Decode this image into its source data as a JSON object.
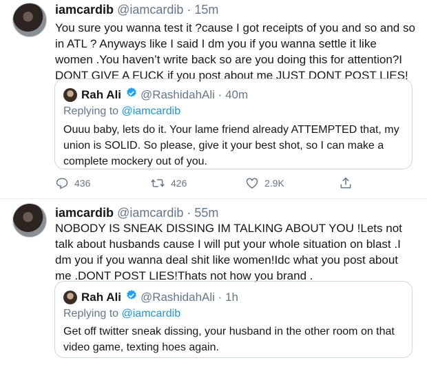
{
  "tweets": [
    {
      "name": "iamcardib",
      "handle": "@iamcardib",
      "separator": "·",
      "time": "15m",
      "text": "You sure you wanna test it ?cause I got receipts of you and so and so in ATL ? Anyways like I said I dm you if you wanna settle it like women .You haven’t write back so are you doing this for attention?I DONT GIVE A FUCK if you post about me JUST DONT POST LIES!",
      "quote": {
        "name": "Rah Ali",
        "handle": "@RashidahAli",
        "separator": "·",
        "time": "40m",
        "replying_prefix": "Replying to",
        "replying_to": "@iamcardib",
        "text": "Ouuu baby, lets do it. Your lame friend already ATTEMPTED that, my union is SOLID. So please, give it your best shot, so I can make a complete mockery out of you."
      },
      "actions": {
        "replies": "436",
        "retweets": "426",
        "likes": "2.9K"
      }
    },
    {
      "name": "iamcardib",
      "handle": "@iamcardib",
      "separator": "·",
      "time": "55m",
      "text": "NOBODY IS SNEAK DISSING IM TALKING ABOUT YOU !Lets not talk about husbands cause I will put your whole situation on blast .I dm you if you wanna deal shit like women!Idc what you post about me .DONT POST LIES!Thats not how you brand .",
      "quote": {
        "name": "Rah Ali",
        "handle": "@RashidahAli",
        "separator": "·",
        "time": "1h",
        "replying_prefix": "Replying to",
        "replying_to": "@iamcardib",
        "text": "Get off twitter sneak dissing, your husband in the other room on that video game, texting hoes again."
      }
    }
  ],
  "colors": {
    "accent": "#1da1f2",
    "secondary_text": "#657786",
    "border": "#ccd6dd"
  },
  "icons": [
    "reply-icon",
    "retweet-icon",
    "like-icon",
    "share-icon",
    "verified-icon"
  ]
}
